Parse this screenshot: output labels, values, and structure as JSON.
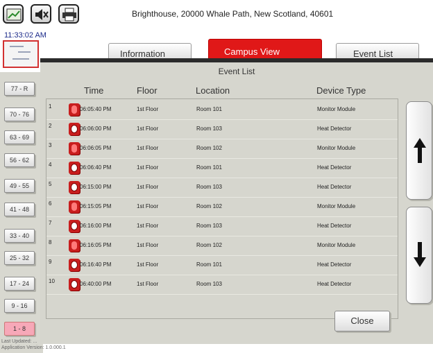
{
  "header": {
    "address": "Brighthouse, 20000 Whale Path, New Scotland, 40601",
    "clock": "11:33:02 AM"
  },
  "tabs": [
    {
      "label": "Information"
    },
    {
      "label": "Campus View"
    },
    {
      "label": "Event List"
    }
  ],
  "range_buttons": [
    "77 - R",
    "70 - 76",
    "63 - 69",
    "56 - 62",
    "49 - 55",
    "41 - 48",
    "33 - 40",
    "25 - 32",
    "17 - 24",
    "9 - 16",
    "1 - 8"
  ],
  "selected_range": "1 - 8",
  "footer": {
    "last_updated": "Last Updated: ...",
    "version": "Application Version: 1.0.000.1"
  },
  "dialog": {
    "title": "Event List",
    "columns": [
      "Time",
      "Floor",
      "Location",
      "Device Type"
    ],
    "close_label": "Close",
    "rows": [
      {
        "num": "1",
        "icon": "monitor-module-icon",
        "time": "06:05:40 PM",
        "floor": "1st Floor",
        "location": "Room 101",
        "device": "Monitor Module"
      },
      {
        "num": "2",
        "icon": "heat-detector-icon",
        "time": "06:06:00 PM",
        "floor": "1st Floor",
        "location": "Room 103",
        "device": "Heat Detector"
      },
      {
        "num": "3",
        "icon": "monitor-module-icon",
        "time": "06:06:05 PM",
        "floor": "1st Floor",
        "location": "Room 102",
        "device": "Monitor Module"
      },
      {
        "num": "4",
        "icon": "heat-detector-icon",
        "time": "06:06:40 PM",
        "floor": "1st Floor",
        "location": "Room 101",
        "device": "Heat Detector"
      },
      {
        "num": "5",
        "icon": "heat-detector-icon",
        "time": "06:15:00 PM",
        "floor": "1st Floor",
        "location": "Room 103",
        "device": "Heat Detector"
      },
      {
        "num": "6",
        "icon": "monitor-module-icon",
        "time": "06:15:05 PM",
        "floor": "1st Floor",
        "location": "Room 102",
        "device": "Monitor Module"
      },
      {
        "num": "7",
        "icon": "heat-detector-icon",
        "time": "06:16:00 PM",
        "floor": "1st Floor",
        "location": "Room 103",
        "device": "Heat Detector"
      },
      {
        "num": "8",
        "icon": "monitor-module-icon",
        "time": "06:16:05 PM",
        "floor": "1st Floor",
        "location": "Room 102",
        "device": "Monitor Module"
      },
      {
        "num": "9",
        "icon": "heat-detector-icon",
        "time": "06:16:40 PM",
        "floor": "1st Floor",
        "location": "Room 101",
        "device": "Heat Detector"
      },
      {
        "num": "10",
        "icon": "heat-detector-icon",
        "time": "06:40:00 PM",
        "floor": "1st Floor",
        "location": "Room 103",
        "device": "Heat Detector"
      }
    ]
  },
  "colors": {
    "accent_red": "#e01818",
    "selected_range": "#f7a8b8",
    "panel": "#d6d6ce"
  }
}
